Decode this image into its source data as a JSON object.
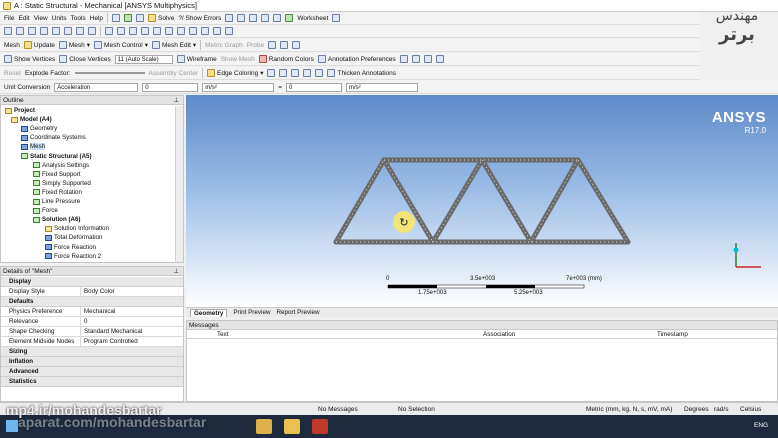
{
  "window": {
    "title": "A : Static Structural - Mechanical [ANSYS Multiphysics]"
  },
  "menu": [
    "File",
    "Edit",
    "View",
    "Units",
    "Tools",
    "Help"
  ],
  "toolbar1": {
    "solve": "Solve",
    "show_errors": "?/ Show Errors",
    "worksheet": "Worksheet"
  },
  "toolbar2": {
    "mesh": "Mesh",
    "update": "Update",
    "mesh_dd": "Mesh",
    "mesh_control": "Mesh Control",
    "mesh_edit": "Mesh Edit",
    "metric_graph": "Metric Graph",
    "probe": "Probe"
  },
  "toolbar3": {
    "show_vertices": "Show Vertices",
    "close_vertices": "Close Vertices",
    "auto_scale": "11 (Auto Scale)",
    "wireframe": "Wireframe",
    "show_mesh": "Show Mesh",
    "random_colors": "Random Colors",
    "annotation_prefs": "Annotation Preferences"
  },
  "toolbar4": {
    "reset": "Reset",
    "explode_factor": "Explode Factor:",
    "assembly_center": "Assembly Center",
    "edge_coloring": "Edge Coloring",
    "thicken": "Thicken Annotations"
  },
  "unitbar": {
    "label": "Unit Conversion",
    "quantity": "Acceleration",
    "val1": "0",
    "unit1": "m/s²",
    "eq": "=",
    "val2": "0",
    "unit2": "m/s²"
  },
  "outline": {
    "header": "Outline",
    "items": [
      {
        "label": "Project",
        "bold": true
      },
      {
        "label": "Model (A4)",
        "bold": true
      },
      {
        "label": "Geometry"
      },
      {
        "label": "Coordinate Systems"
      },
      {
        "label": "Mesh",
        "selected": true
      },
      {
        "label": "Static Structural (A5)",
        "bold": true
      },
      {
        "label": "Analysis Settings"
      },
      {
        "label": "Fixed Support"
      },
      {
        "label": "Simply Supported"
      },
      {
        "label": "Fixed Rotation"
      },
      {
        "label": "Line Pressure"
      },
      {
        "label": "Force"
      },
      {
        "label": "Solution (A6)",
        "bold": true
      },
      {
        "label": "Solution Information"
      },
      {
        "label": "Total Deformation"
      },
      {
        "label": "Force Reaction"
      },
      {
        "label": "Force Reaction 2"
      }
    ]
  },
  "details": {
    "header": "Details of \"Mesh\"",
    "groups": [
      {
        "name": "Display",
        "rows": [
          {
            "k": "Display Style",
            "v": "Body Color"
          }
        ]
      },
      {
        "name": "Defaults",
        "rows": [
          {
            "k": "Physics Preference",
            "v": "Mechanical"
          },
          {
            "k": "Relevance",
            "v": "0"
          },
          {
            "k": "Shape Checking",
            "v": "Standard Mechanical"
          },
          {
            "k": "Element Midside Nodes",
            "v": "Program Controlled"
          }
        ]
      }
    ],
    "collapsed": [
      "Sizing",
      "Inflation",
      "Advanced",
      "Statistics"
    ]
  },
  "viewport": {
    "brand": "ANSYS",
    "release": "R17.0",
    "scale_labels_top": [
      "0",
      "3.5e+003",
      "7e+003 (mm)"
    ],
    "scale_labels_bottom": [
      "1.75e+003",
      "5.25e+003"
    ]
  },
  "bottom_tabs": [
    "Geometry",
    "Print Preview",
    "Report Preview"
  ],
  "messages": {
    "header": "Messages",
    "cols": [
      "Text",
      "Association",
      "Timestamp"
    ]
  },
  "status": {
    "no_messages": "No Messages",
    "no_selection": "No Selection",
    "units": "Metric (mm, kg, N, s, mV, mA)",
    "degrees": "Degrees",
    "rads": "rad/s",
    "celsius": "Celsius"
  },
  "watermark": {
    "bottom": "mp4.ir/mohandesbartar",
    "bottom2": "aparat.com/mohandesbartar",
    "logo_line1": "مهندس",
    "logo_line2": "برتر"
  },
  "taskbar": {
    "lang": "ENG"
  }
}
